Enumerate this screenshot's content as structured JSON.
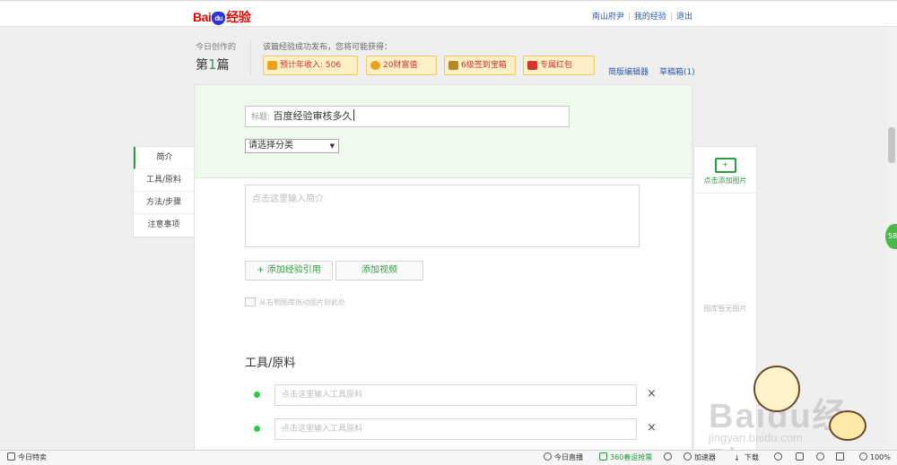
{
  "header": {
    "logo_text": "Bai",
    "logo_paw": "du",
    "logo_suffix": "经验",
    "links": [
      "南山府尹",
      "我的经验",
      "退出"
    ]
  },
  "stats": {
    "today_label": "今日创作的",
    "count_prefix": "第",
    "count_value": "1",
    "count_suffix": "篇",
    "reward_label": "该篇经验成功发布，您将可能获得：",
    "rewards": [
      "预计年收入: 506",
      "20财富值",
      "6级签到宝箱",
      "专属红包"
    ]
  },
  "editor_links": [
    "简版编辑器",
    "草稿箱(1)"
  ],
  "form": {
    "title_label": "标题:",
    "title_value": "百度经验审核多久",
    "category_select": "请选择分类",
    "intro_placeholder": "点击这里输入简介",
    "add_quote_button": "+ 添加经验引用",
    "add_video_button": "添加视频",
    "drag_hint": "从右侧图库拖动图片到此处",
    "tools_title": "工具/原料",
    "tool_placeholder_1": "点击这里输入工具原料",
    "tool_placeholder_2": "点击这里输入工具原料"
  },
  "sidenav": [
    "简介",
    "工具/原料",
    "方法/步骤",
    "注意事项"
  ],
  "right_panel": {
    "add_image": "点击添加图片",
    "no_image": "图库暂无图片"
  },
  "float_badge": "58",
  "watermark": {
    "main": "Baidu经验",
    "sub": "jingyan.baidu.com"
  },
  "statusbar": {
    "left": "今日特卖",
    "live": "今日直播",
    "tickets": "360春运抢票",
    "accelerator": "加速器",
    "download": "下载",
    "zoom": "100%"
  },
  "colors": {
    "accent_green": "#2e9d40",
    "brand_red": "#e10601",
    "link_blue": "#2b5aa8"
  }
}
